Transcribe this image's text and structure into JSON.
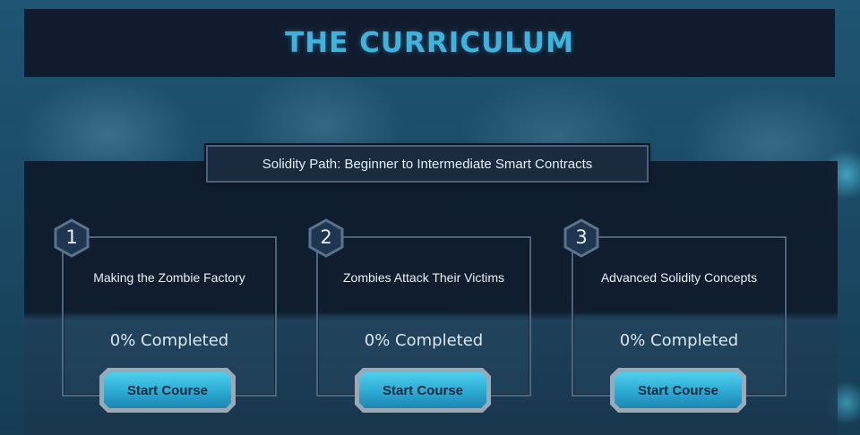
{
  "header": {
    "title": "THE CURRICULUM"
  },
  "path": {
    "label": "Solidity Path: Beginner to Intermediate Smart Contracts"
  },
  "courses": [
    {
      "number": "1",
      "title": "Making the Zombie Factory",
      "progress": "0% Completed",
      "button_label": "Start Course"
    },
    {
      "number": "2",
      "title": "Zombies Attack Their Victims",
      "progress": "0% Completed",
      "button_label": "Start Course"
    },
    {
      "number": "3",
      "title": "Advanced Solidity Concepts",
      "progress": "0% Completed",
      "button_label": "Start Course"
    }
  ],
  "colors": {
    "accent": "#3fb2dd",
    "button": "#2ba9d3",
    "panel": "#101c2e"
  }
}
